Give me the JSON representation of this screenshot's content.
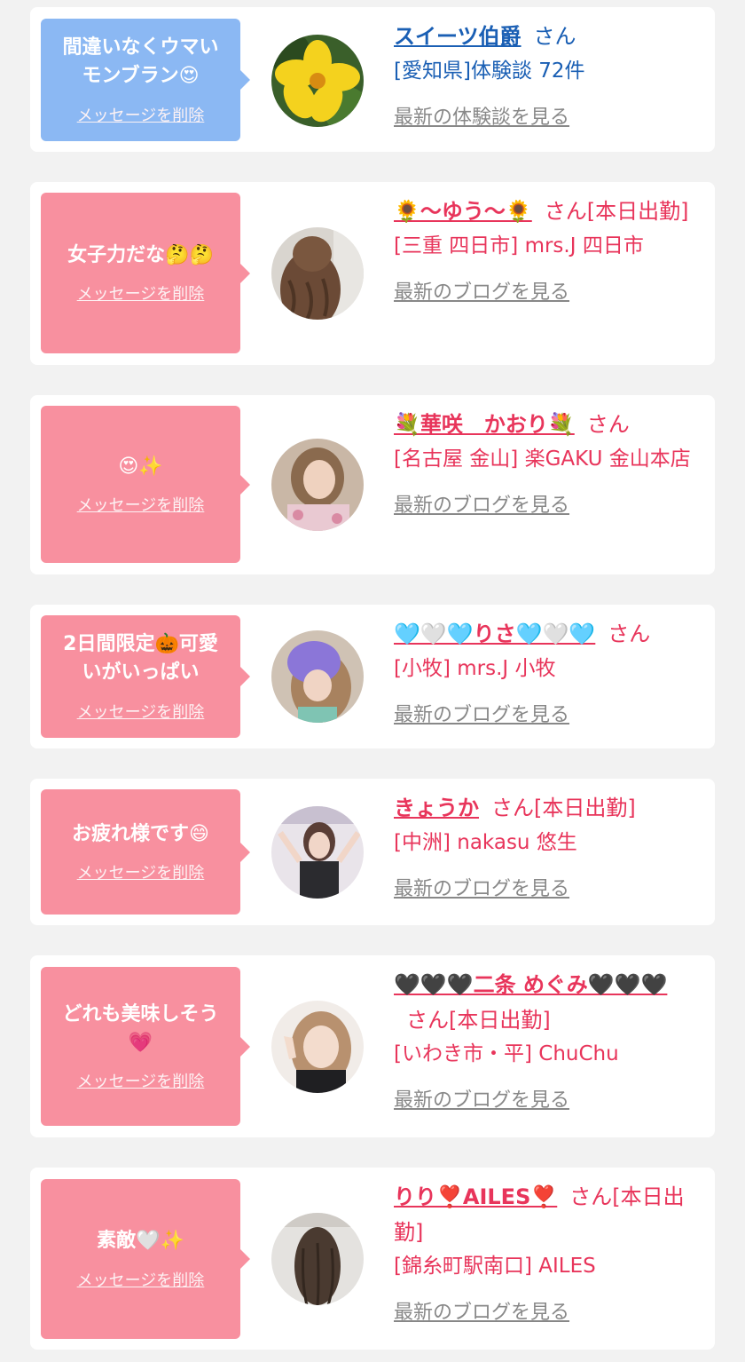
{
  "colors": {
    "bubble_blue": "#8bb8f3",
    "bubble_pink": "#f8909f",
    "text_blue": "#1a5fb4",
    "text_pink": "#e8355b",
    "link_gray": "#888888"
  },
  "entries": [
    {
      "message": "間違いなくウマい\nモンブラン😍",
      "delete_label": "メッセージを削除",
      "name": "スイーツ伯爵",
      "suffix": "さん",
      "shop": "[愛知県]体験談 72件",
      "link": "最新の体験談を見る",
      "avatar": "yellow-hibiscus-photo"
    },
    {
      "message": "女子力だな🤔🤔",
      "delete_label": "メッセージを削除",
      "name": "🌻〜ゆう〜🌻",
      "suffix": "さん[本日出勤]",
      "shop": "[三重 四日市] mrs.J 四日市",
      "link": "最新のブログを見る",
      "avatar": "wavy-hair-photo"
    },
    {
      "message": "😍✨",
      "delete_label": "メッセージを削除",
      "name": "💐華咲　かおり💐",
      "suffix": "さん",
      "shop": "[名古屋 金山] 楽GAKU 金山本店",
      "link": "最新のブログを見る",
      "avatar": "portrait-photo"
    },
    {
      "message": "2日間限定🎃可愛\nいがいっぱい",
      "delete_label": "メッセージを削除",
      "name": "🩵🤍🩵りさ🩵🤍🩵",
      "suffix": "さん",
      "shop": "[小牧] mrs.J 小牧",
      "link": "最新のブログを見る",
      "avatar": "purple-hair-photo"
    },
    {
      "message": "お疲れ様です😄",
      "delete_label": "メッセージを削除",
      "name": "きょうか",
      "suffix": "さん[本日出勤]",
      "shop": "[中洲] nakasu 悠生",
      "link": "最新のブログを見る",
      "avatar": "room-selfie-photo"
    },
    {
      "message": "どれも美味しそう\n💗",
      "delete_label": "メッセージを削除",
      "name": "🖤🖤🖤二条 めぐみ🖤🖤🖤",
      "suffix": "さん[本日出勤]",
      "shop": "[いわき市・平] ChuChu",
      "link": "最新のブログを見る",
      "avatar": "peace-sign-photo"
    },
    {
      "message": "素敵🤍✨",
      "delete_label": "メッセージを削除",
      "name": "りり❣️AILES❣️",
      "suffix": "さん[本日出勤]",
      "shop": "[錦糸町駅南口] AILES",
      "link": "最新のブログを見る",
      "avatar": "long-hair-back-photo"
    }
  ]
}
